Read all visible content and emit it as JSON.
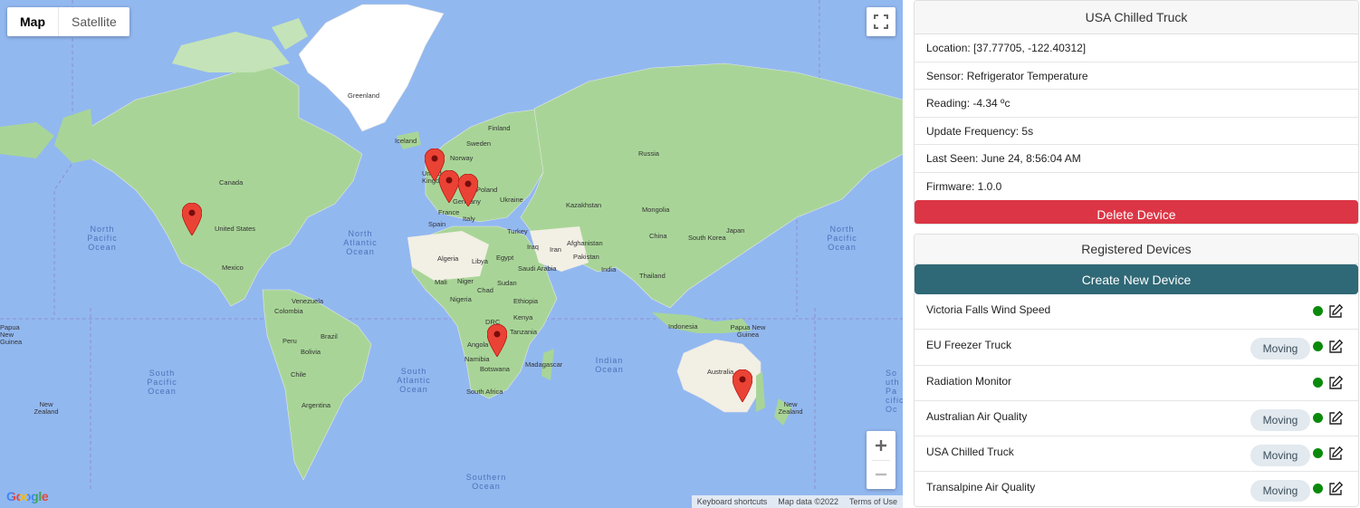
{
  "map": {
    "type_controls": [
      "Map",
      "Satellite"
    ],
    "active_type": "Map",
    "attribution": [
      "Keyboard shortcuts",
      "Map data ©2022",
      "Terms of Use"
    ],
    "logo": "Google",
    "labels": [
      "Greenland",
      "Iceland",
      "Finland",
      "Norway",
      "Sweden",
      "United Kingdom",
      "Poland",
      "Germany",
      "France",
      "Spain",
      "Italy",
      "Ukraine",
      "Kazakhstan",
      "Mongolia",
      "China",
      "Japan",
      "South Korea",
      "Turkey",
      "Iraq",
      "Iran",
      "Afghanistan",
      "Pakistan",
      "India",
      "Thailand",
      "Saudi Arabia",
      "Egypt",
      "Libya",
      "Algeria",
      "Mali",
      "Niger",
      "Chad",
      "Sudan",
      "Nigeria",
      "Ethiopia",
      "Kenya",
      "DRC",
      "Tanzania",
      "Angola",
      "Namibia",
      "Botswana",
      "South Africa",
      "Madagascar",
      "Indonesia",
      "Papua New Guinea",
      "Papua New Guinea",
      "Australia",
      "New Zealand",
      "New Zealand",
      "Canada",
      "United States",
      "Mexico",
      "Venezuela",
      "Colombia",
      "Peru",
      "Brazil",
      "Bolivia",
      "Chile",
      "Argentina",
      "Russia"
    ],
    "oceans": [
      "North Pacific Ocean",
      "North Atlantic Ocean",
      "North Pacific Ocean",
      "South Pacific Ocean",
      "South Atlantic Ocean",
      "Indian Ocean",
      "Southern Ocean",
      "So uth Pa cific Oc"
    ]
  },
  "device_detail": {
    "title": "USA Chilled Truck",
    "location": "Location: [37.77705, -122.40312]",
    "sensor": "Sensor: Refrigerator Temperature",
    "reading": "Reading: -4.34 ºc",
    "update_frequency": "Update Frequency: 5s",
    "last_seen": "Last Seen: June 24, 8:56:04 AM",
    "firmware": "Firmware: 1.0.0",
    "delete_label": "Delete Device"
  },
  "registered": {
    "title": "Registered Devices",
    "create_label": "Create New Device",
    "devices": [
      {
        "name": "Victoria Falls Wind Speed",
        "moving": "",
        "status_color": "#0a8a0a"
      },
      {
        "name": "EU Freezer Truck",
        "moving": "Moving",
        "status_color": "#0a8a0a"
      },
      {
        "name": "Radiation Monitor",
        "moving": "",
        "status_color": "#0a8a0a"
      },
      {
        "name": "Australian Air Quality",
        "moving": "Moving",
        "status_color": "#0a8a0a"
      },
      {
        "name": "USA Chilled Truck",
        "moving": "Moving",
        "status_color": "#0a8a0a"
      },
      {
        "name": "Transalpine Air Quality",
        "moving": "Moving",
        "status_color": "#0a8a0a"
      }
    ]
  },
  "colors": {
    "delete": "#dc3545",
    "create": "#2f6876",
    "status_online": "#0a8a0a",
    "marker": "#ea4335"
  }
}
